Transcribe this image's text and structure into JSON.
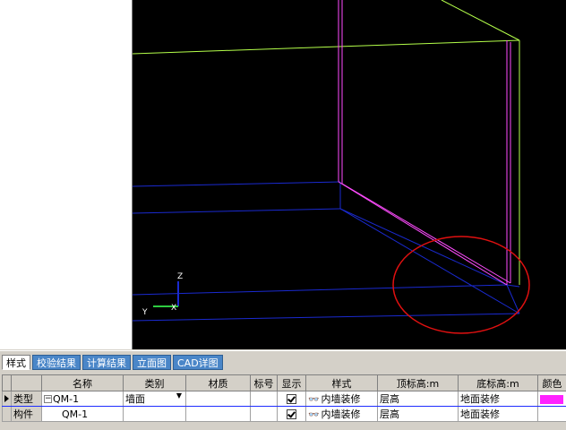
{
  "viewport": {
    "axis": {
      "z": "Z",
      "y": "Y",
      "x": "X"
    },
    "colors": {
      "background": "#000000",
      "lime": "#b4ff4a",
      "magenta": "#ff4cff",
      "blue": "#1a2ad0",
      "highlight": "#e01010"
    }
  },
  "tabs": [
    {
      "label": "样式",
      "active": true
    },
    {
      "label": "校验结果"
    },
    {
      "label": "计算结果"
    },
    {
      "label": "立面图"
    },
    {
      "label": "CAD详图"
    }
  ],
  "grid": {
    "headers": [
      "名称",
      "类别",
      "材质",
      "标号",
      "显示",
      "样式",
      "顶标高:m",
      "底标高:m",
      "颜色"
    ],
    "rows": [
      {
        "type": "类型",
        "name": "QM-1",
        "category": "墙面",
        "material": "",
        "grade": "",
        "shown": true,
        "style": "内墙装修",
        "top": "层高",
        "bottom": "地面装修",
        "color": "#ff22ff"
      },
      {
        "type": "构件",
        "name": "QM-1",
        "category": "",
        "material": "",
        "grade": "",
        "shown": true,
        "style": "内墙装修",
        "top": "层高",
        "bottom": "地面装修",
        "color": ""
      }
    ]
  }
}
